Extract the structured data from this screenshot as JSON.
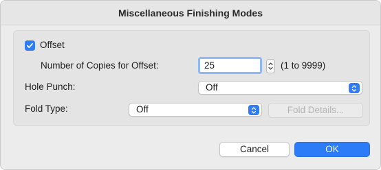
{
  "dialog": {
    "title": "Miscellaneous Finishing Modes"
  },
  "offset": {
    "checkbox_label": "Offset",
    "checked": true,
    "copies_label": "Number of Copies for Offset:",
    "copies_value": "25",
    "range_text": "(1 to 9999)"
  },
  "hole_punch": {
    "label": "Hole Punch:",
    "value": "Off"
  },
  "fold_type": {
    "label": "Fold Type:",
    "value": "Off",
    "details_button": "Fold Details..."
  },
  "buttons": {
    "cancel": "Cancel",
    "ok": "OK"
  },
  "colors": {
    "accent": "#2b7cf6",
    "focus_ring": "#8fb8f7",
    "dialog_bg": "#ececec",
    "panel_bg": "#e4e4e4"
  }
}
